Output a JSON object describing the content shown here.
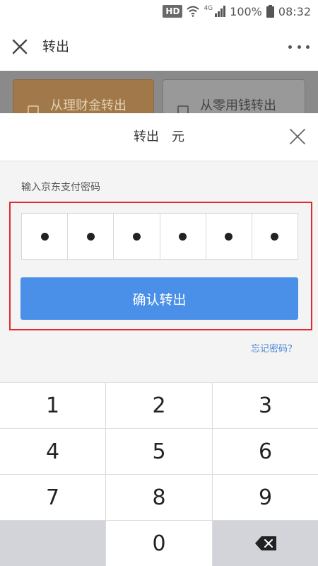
{
  "status_bar": {
    "hd_badge": "HD",
    "network": "4G",
    "battery": "100%",
    "time": "08:32"
  },
  "header": {
    "title": "转出",
    "close_icon": "close-icon",
    "more_icon": "more-dots-icon"
  },
  "background_tabs": [
    {
      "label": "从理财金转出",
      "active": true
    },
    {
      "label": "从零用钱转出",
      "active": false
    }
  ],
  "sheet": {
    "title": "转出",
    "unit": "元",
    "password_label": "输入京东支付密码",
    "password_length": 6,
    "password_filled": 6,
    "confirm_label": "确认转出",
    "forgot_label": "忘记密码？"
  },
  "keypad": {
    "keys": [
      "1",
      "2",
      "3",
      "4",
      "5",
      "6",
      "7",
      "8",
      "9",
      "",
      "0",
      "⌫"
    ]
  },
  "colors": {
    "accent_blue": "#4a90e8",
    "highlight_red": "#e0282e",
    "link_blue": "#4a86d4"
  }
}
